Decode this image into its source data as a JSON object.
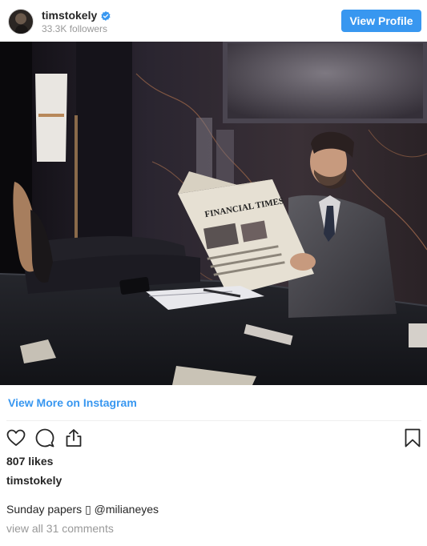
{
  "header": {
    "username": "timstokely",
    "followers": "33.3K followers",
    "view_profile_label": "View Profile"
  },
  "photo": {
    "newspaper_masthead": "FINANCIAL TIMES"
  },
  "links": {
    "view_more": "View More on Instagram"
  },
  "actions": {
    "like_icon": "heart-icon",
    "comment_icon": "comment-icon",
    "share_icon": "share-icon",
    "save_icon": "bookmark-icon"
  },
  "post": {
    "likes": "807 likes",
    "caption_username": "timstokely",
    "caption_text": "Sunday papers ▯ ",
    "caption_mention": "@milianeyes",
    "comments_link": "view all 31 comments"
  },
  "colors": {
    "accent": "#3897f0",
    "text": "#262626",
    "muted": "#999999",
    "divider": "#efefef"
  }
}
